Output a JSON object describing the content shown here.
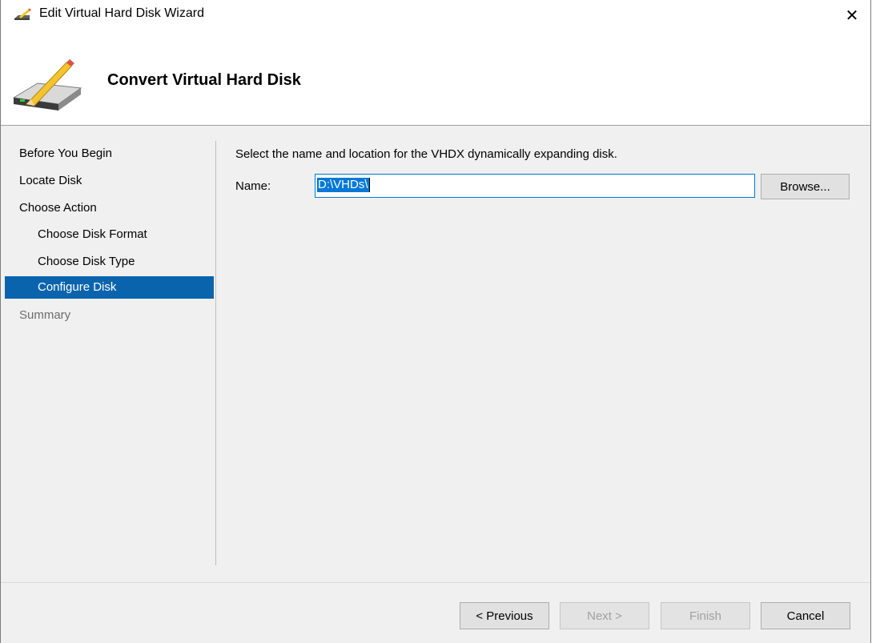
{
  "window": {
    "title": "Edit Virtual Hard Disk Wizard",
    "close_symbol": "✕"
  },
  "header": {
    "title": "Convert Virtual Hard Disk"
  },
  "sidebar": {
    "items": [
      {
        "label": "Before You Begin",
        "state": "normal"
      },
      {
        "label": "Locate Disk",
        "state": "normal"
      },
      {
        "label": "Choose Action",
        "state": "normal"
      },
      {
        "label": "Choose Disk Format",
        "state": "normal"
      },
      {
        "label": "Choose Disk Type",
        "state": "normal"
      },
      {
        "label": "Configure Disk",
        "state": "active"
      },
      {
        "label": "Summary",
        "state": "disabled"
      }
    ]
  },
  "content": {
    "instruction": "Select the name and location for the VHDX dynamically expanding disk.",
    "name_label": "Name:",
    "name_value": "D:\\VHDs\\",
    "browse_label": "Browse..."
  },
  "footer": {
    "previous_label": "< Previous",
    "next_label": "Next >",
    "finish_label": "Finish",
    "cancel_label": "Cancel"
  },
  "colors": {
    "selection": "#0a64ad",
    "input_focus": "#0078d7"
  },
  "icons": {
    "app": "edit-disk-icon",
    "header": "hard-disk-pencil-icon",
    "close": "close-icon"
  }
}
